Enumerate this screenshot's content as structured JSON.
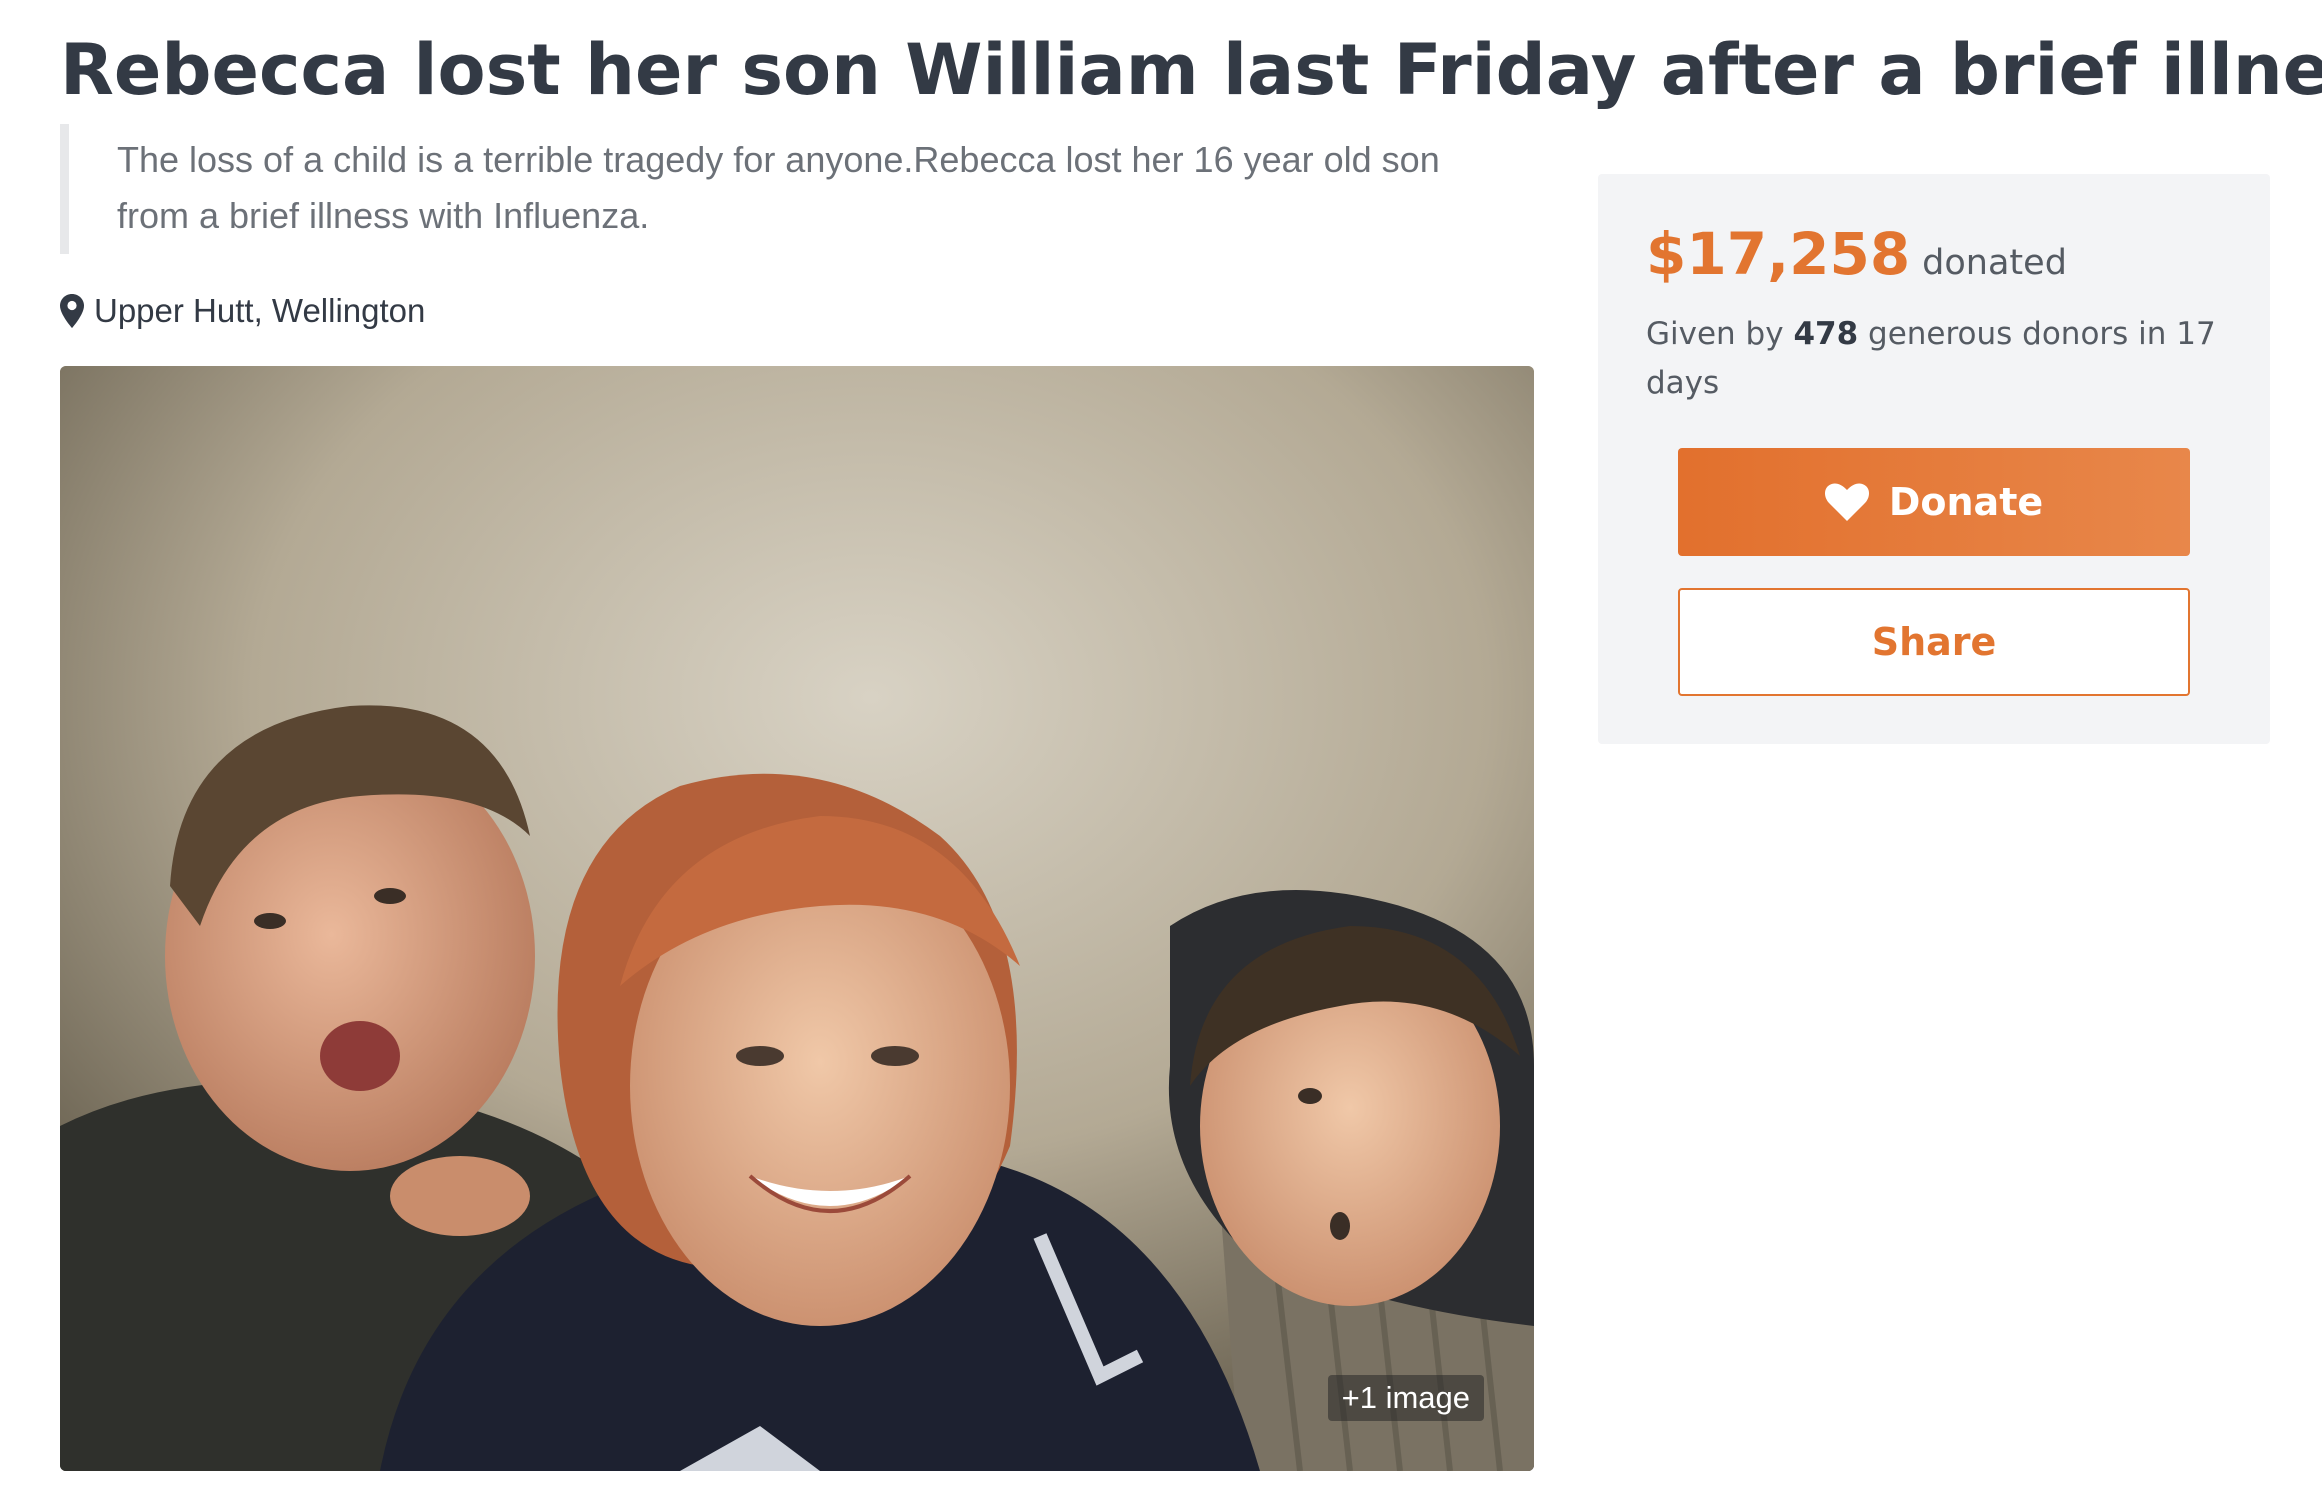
{
  "campaign": {
    "title": "Rebecca lost her son William last Friday after a brief illness",
    "summary": "The loss of a child is a terrible tragedy for anyone.Rebecca lost her 16 year old son from a brief illness with Influenza.",
    "location": "Upper Hutt, Wellington",
    "location_icon": "map-pin-icon"
  },
  "media": {
    "more_images_label": "+1 image"
  },
  "donation": {
    "amount": "$17,258",
    "amount_suffix": "donated",
    "donors_prefix": "Given by",
    "donor_count": "478",
    "donors_suffix": "generous donors in 17 days",
    "donate_label": "Donate",
    "donate_icon": "heart-icon",
    "share_label": "Share"
  },
  "colors": {
    "accent": "#e27530",
    "text_dark": "#333a45",
    "sidebar_bg": "#f3f4f6"
  }
}
